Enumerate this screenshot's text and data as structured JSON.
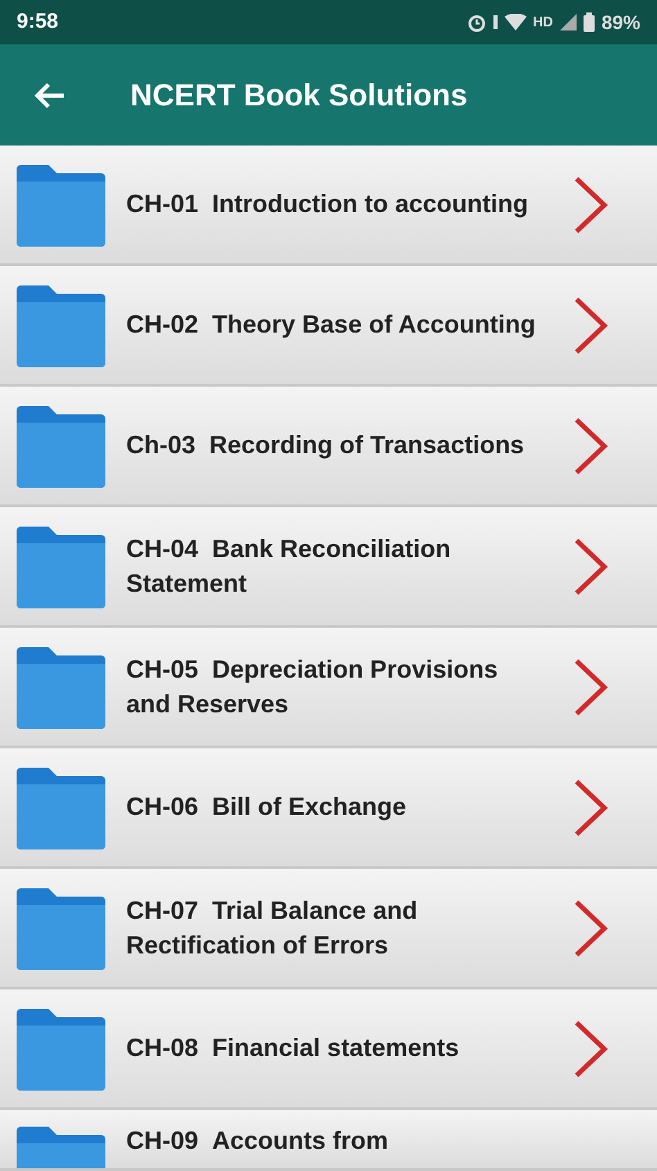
{
  "status_bar": {
    "time": "9:58",
    "network_label": "HD",
    "battery": "89%"
  },
  "app_bar": {
    "title": "NCERT Book Solutions"
  },
  "chapters": [
    {
      "code": "CH-01",
      "title": "Introduction to accounting"
    },
    {
      "code": "CH-02",
      "title": "Theory Base of Accounting"
    },
    {
      "code": "Ch-03",
      "title": "Recording of Transactions"
    },
    {
      "code": "CH-04",
      "title": "Bank Reconciliation Statement"
    },
    {
      "code": "CH-05",
      "title": "Depreciation Provisions and Reserves"
    },
    {
      "code": "CH-06",
      "title": "Bill of Exchange"
    },
    {
      "code": "CH-07",
      "title": "Trial Balance and Rectification of Errors"
    },
    {
      "code": "CH-08",
      "title": "Financial statements"
    },
    {
      "code": "CH-09",
      "title": "Accounts from"
    }
  ]
}
